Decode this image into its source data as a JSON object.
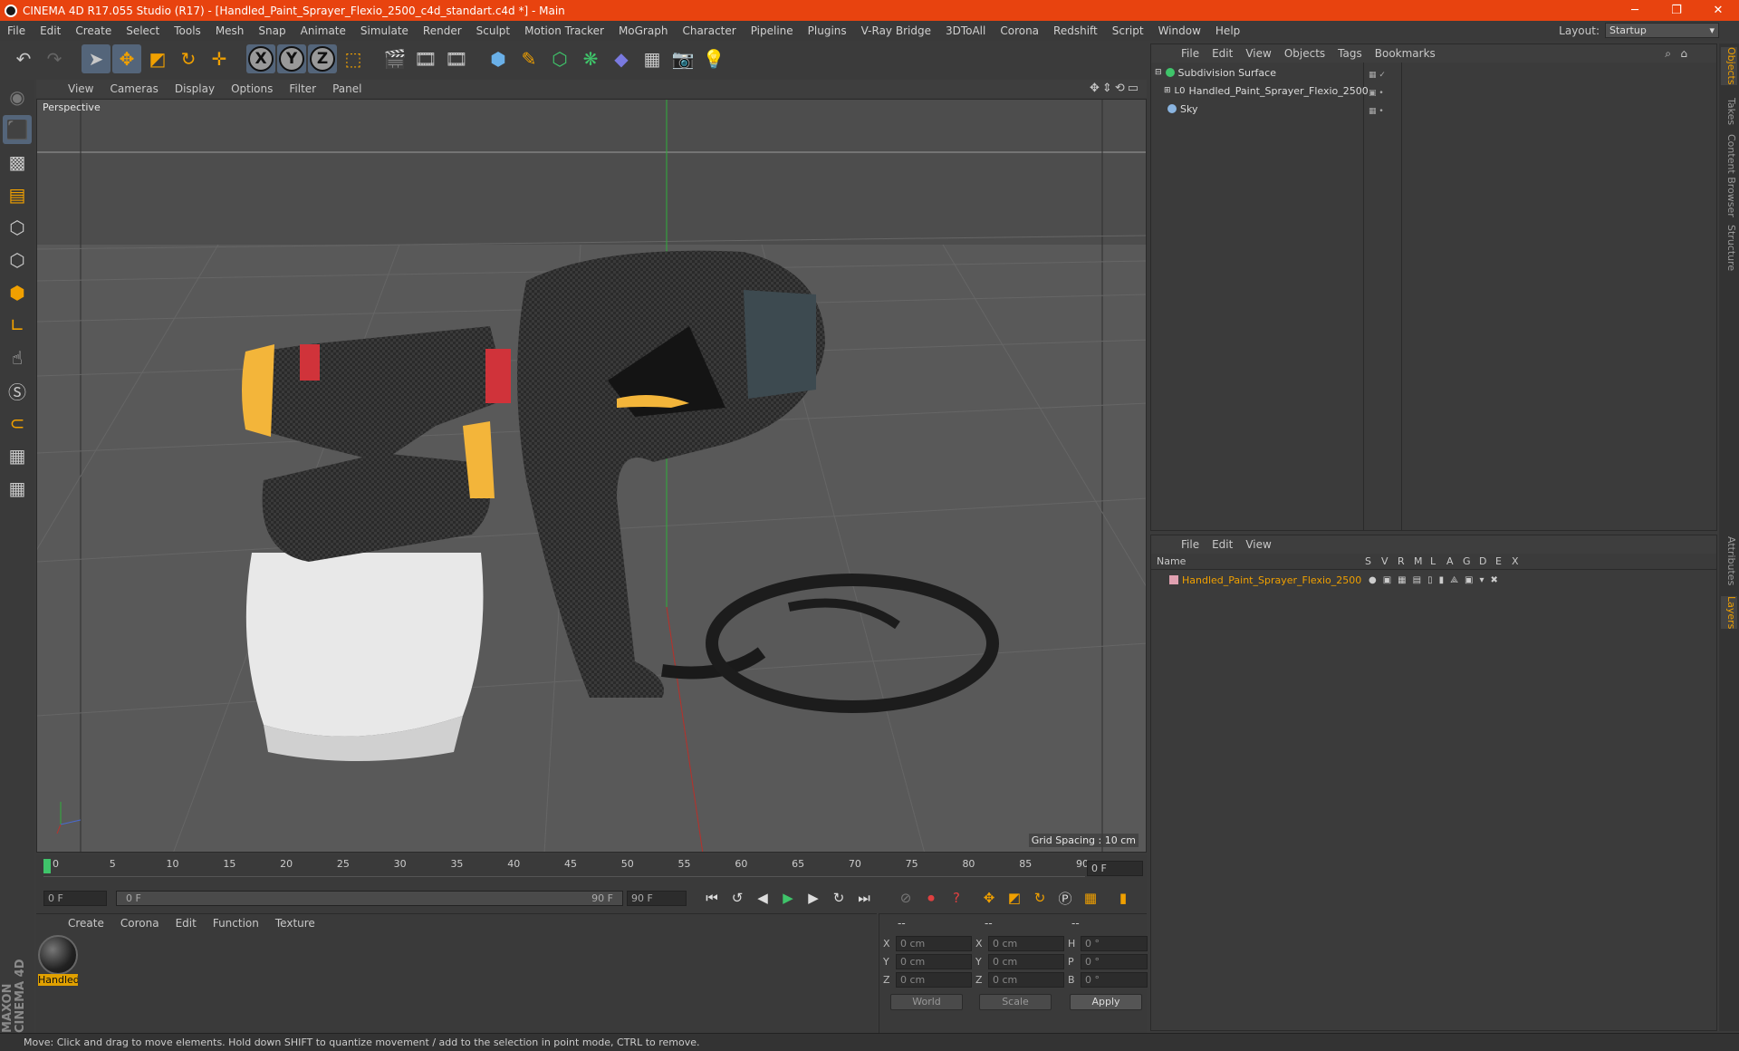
{
  "window": {
    "title": "CINEMA 4D R17.055 Studio (R17) - [Handled_Paint_Sprayer_Flexio_2500_c4d_standart.c4d *] - Main",
    "minimize": "─",
    "restore": "❐",
    "close": "✕"
  },
  "menubar": {
    "items": [
      "File",
      "Edit",
      "Create",
      "Select",
      "Tools",
      "Mesh",
      "Snap",
      "Animate",
      "Simulate",
      "Render",
      "Sculpt",
      "Motion Tracker",
      "MoGraph",
      "Character",
      "Pipeline",
      "Plugins",
      "V-Ray Bridge",
      "3DToAll",
      "Corona",
      "Redshift",
      "Script",
      "Window",
      "Help"
    ],
    "layout_label": "Layout:",
    "layout_value": "Startup"
  },
  "toolbar": {
    "axis_x": "X",
    "axis_y": "Y",
    "axis_z": "Z"
  },
  "viewport": {
    "menu": [
      "View",
      "Cameras",
      "Display",
      "Options",
      "Filter",
      "Panel"
    ],
    "label": "Perspective",
    "grid_spacing": "Grid Spacing : 10 cm"
  },
  "timeline": {
    "ticks": [
      "0",
      "5",
      "10",
      "15",
      "20",
      "25",
      "30",
      "35",
      "40",
      "45",
      "50",
      "55",
      "60",
      "65",
      "70",
      "75",
      "80",
      "85",
      "90"
    ],
    "current_frame": "0 F",
    "start_field": "0 F",
    "range_start": "0 F",
    "range_end": "90 F",
    "end_field": "90 F"
  },
  "material_panel": {
    "menu": [
      "Create",
      "Corona",
      "Edit",
      "Function",
      "Texture"
    ],
    "material_name": "Handled"
  },
  "coord_panel": {
    "header": [
      "--",
      "--",
      "--"
    ],
    "rows": [
      {
        "a": "X",
        "av": "0 cm",
        "b": "X",
        "bv": "0 cm",
        "c": "H",
        "cv": "0 °"
      },
      {
        "a": "Y",
        "av": "0 cm",
        "b": "Y",
        "bv": "0 cm",
        "c": "P",
        "cv": "0 °"
      },
      {
        "a": "Z",
        "av": "0 cm",
        "b": "Z",
        "bv": "0 cm",
        "c": "B",
        "cv": "0 °"
      }
    ],
    "world": "World",
    "scale": "Scale",
    "apply": "Apply"
  },
  "object_panel": {
    "menu": [
      "File",
      "Edit",
      "View",
      "Objects",
      "Tags",
      "Bookmarks"
    ],
    "objects": [
      "Subdivision Surface",
      "Handled_Paint_Sprayer_Flexio_2500",
      "Sky"
    ]
  },
  "layer_panel": {
    "menu": [
      "File",
      "Edit",
      "View"
    ],
    "col_name": "Name",
    "cols": [
      "S",
      "V",
      "R",
      "M",
      "L",
      "A",
      "G",
      "D",
      "E",
      "X"
    ],
    "layer_name": "Handled_Paint_Sprayer_Flexio_2500"
  },
  "right_tabs": [
    "Objects",
    "Takes",
    "Content Browser",
    "Structure",
    "Attributes",
    "Layers"
  ],
  "maxon": "MAXON CINEMA 4D",
  "status": "Move: Click and drag to move elements. Hold down SHIFT to quantize movement / add to the selection in point mode, CTRL to remove.",
  "colors": {
    "title_bar": "#e8430f",
    "accent": "#f0a000",
    "selection": "#54657a"
  }
}
